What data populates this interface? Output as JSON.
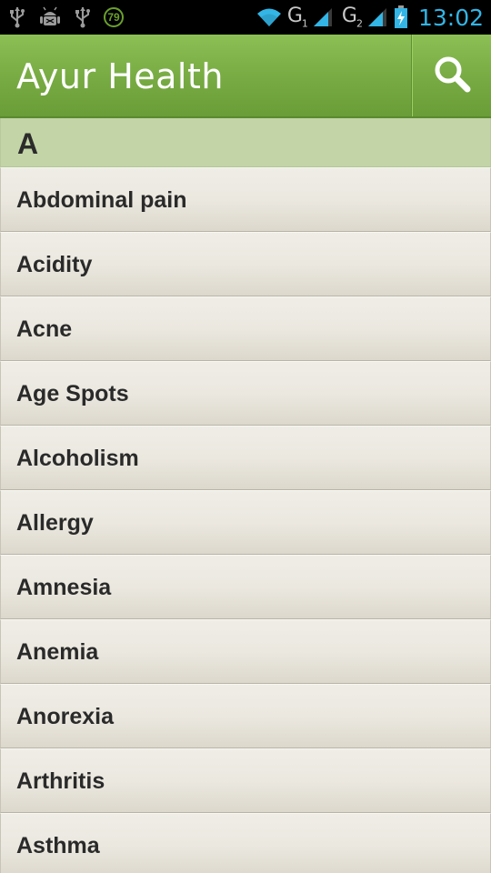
{
  "status_bar": {
    "notification_count": "79",
    "network_1": "G",
    "network_1_sub": "1",
    "network_2": "G",
    "network_2_sub": "2",
    "time": "13:02",
    "icon_color": "#33b5e5"
  },
  "action_bar": {
    "title": "Ayur Health",
    "search_icon": "search-icon",
    "color": "#7cb045"
  },
  "list": {
    "section_header": "A",
    "items": [
      {
        "label": "Abdominal pain"
      },
      {
        "label": "Acidity"
      },
      {
        "label": "Acne"
      },
      {
        "label": "Age Spots"
      },
      {
        "label": "Alcoholism"
      },
      {
        "label": "Allergy"
      },
      {
        "label": "Amnesia"
      },
      {
        "label": "Anemia"
      },
      {
        "label": "Anorexia"
      },
      {
        "label": "Arthritis"
      },
      {
        "label": "Asthma"
      }
    ]
  }
}
